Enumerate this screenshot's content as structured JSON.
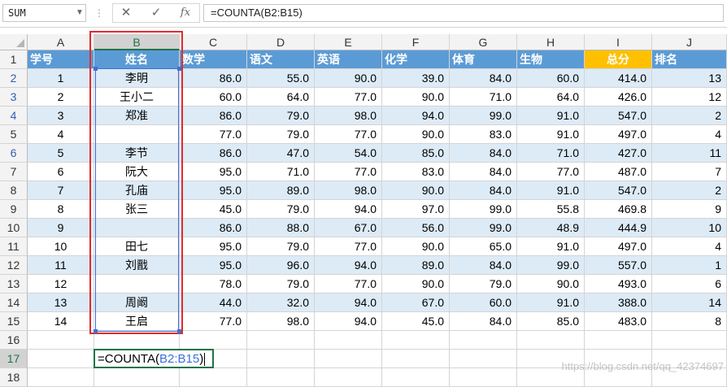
{
  "name_box": "SUM",
  "formula_bar": {
    "cancel_icon": "✕",
    "enter_icon": "✓",
    "fx_label": "fx",
    "formula": "=COUNTA(B2:B15)"
  },
  "columns": [
    "A",
    "B",
    "C",
    "D",
    "E",
    "F",
    "G",
    "H",
    "I",
    "J"
  ],
  "rows": [
    "1",
    "2",
    "3",
    "4",
    "5",
    "6",
    "7",
    "8",
    "9",
    "10",
    "11",
    "12",
    "13",
    "14",
    "15",
    "16",
    "17",
    "18"
  ],
  "header_row": [
    "学号",
    "姓名",
    "数学",
    "语文",
    "英语",
    "化学",
    "体育",
    "生物",
    "总分",
    "排名"
  ],
  "table": [
    [
      "1",
      "李明",
      "86.0",
      "55.0",
      "90.0",
      "39.0",
      "84.0",
      "60.0",
      "414.0",
      "13"
    ],
    [
      "2",
      "王小二",
      "60.0",
      "64.0",
      "77.0",
      "90.0",
      "71.0",
      "64.0",
      "426.0",
      "12"
    ],
    [
      "3",
      "郑准",
      "86.0",
      "79.0",
      "98.0",
      "94.0",
      "99.0",
      "91.0",
      "547.0",
      "2"
    ],
    [
      "4",
      "",
      "77.0",
      "79.0",
      "77.0",
      "90.0",
      "83.0",
      "91.0",
      "497.0",
      "4"
    ],
    [
      "5",
      "李节",
      "86.0",
      "47.0",
      "54.0",
      "85.0",
      "84.0",
      "71.0",
      "427.0",
      "11"
    ],
    [
      "6",
      "阮大",
      "95.0",
      "71.0",
      "77.0",
      "83.0",
      "84.0",
      "77.0",
      "487.0",
      "7"
    ],
    [
      "7",
      "孔庙",
      "95.0",
      "89.0",
      "98.0",
      "90.0",
      "84.0",
      "91.0",
      "547.0",
      "2"
    ],
    [
      "8",
      "张三",
      "45.0",
      "79.0",
      "94.0",
      "97.0",
      "99.0",
      "55.8",
      "469.8",
      "9"
    ],
    [
      "9",
      "",
      "86.0",
      "88.0",
      "67.0",
      "56.0",
      "99.0",
      "48.9",
      "444.9",
      "10"
    ],
    [
      "10",
      "田七",
      "95.0",
      "79.0",
      "77.0",
      "90.0",
      "65.0",
      "91.0",
      "497.0",
      "4"
    ],
    [
      "11",
      "刘戬",
      "95.0",
      "96.0",
      "94.0",
      "89.0",
      "84.0",
      "99.0",
      "557.0",
      "1"
    ],
    [
      "12",
      "",
      "78.0",
      "79.0",
      "77.0",
      "90.0",
      "79.0",
      "90.0",
      "493.0",
      "6"
    ],
    [
      "13",
      "周阚",
      "44.0",
      "32.0",
      "94.0",
      "67.0",
      "60.0",
      "91.0",
      "388.0",
      "14"
    ],
    [
      "14",
      "王启",
      "77.0",
      "98.0",
      "94.0",
      "45.0",
      "84.0",
      "85.0",
      "483.0",
      "8"
    ]
  ],
  "formula_cell": {
    "prefix": "=COUNTA(",
    "ref": "B2:B15",
    "suffix": ")"
  },
  "watermark": "https://blog.csdn.net/qq_42374697",
  "colors": {
    "header_fill": "#5b9bd5",
    "total_header_fill": "#ffc000",
    "band_fill": "#ddebf7",
    "selection_red": "#e22a2a",
    "reference_blue": "#3f6fd9",
    "active_green": "#217346"
  }
}
